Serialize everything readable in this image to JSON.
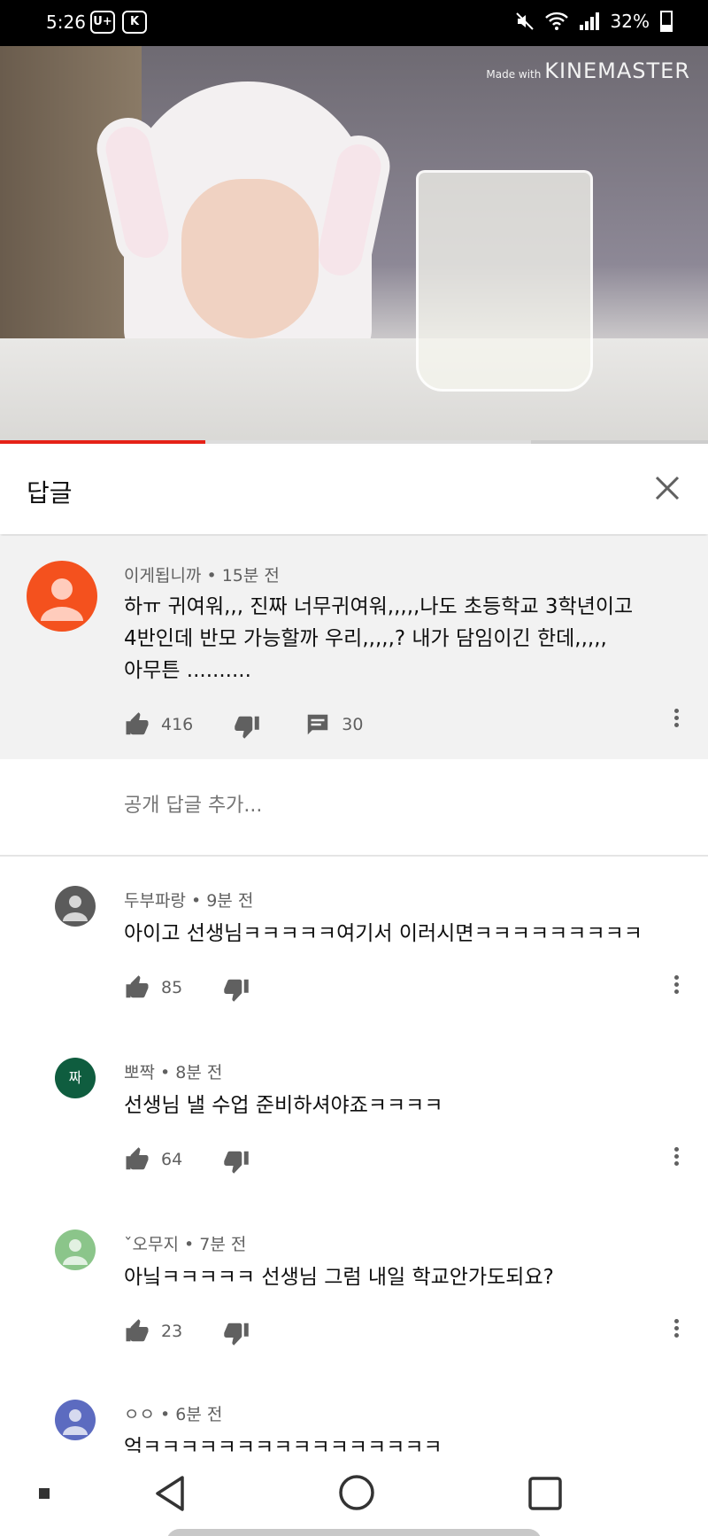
{
  "status_bar": {
    "time": "5:26",
    "left_icons": [
      "U+",
      "K"
    ],
    "right_icons": [
      "mute-icon",
      "wifi-icon",
      "signal-icon"
    ],
    "battery": "32%"
  },
  "video": {
    "watermark_prefix": "Made with",
    "watermark_brand": "KINEMASTER",
    "progress_fraction": 0.29,
    "buffered_fraction": 0.75
  },
  "header": {
    "title": "답글",
    "close_icon": "close-icon"
  },
  "parent_comment": {
    "author": "이게됩니까",
    "time": "15분 전",
    "text_lines": [
      "하ㅠ 귀여워,,, 진짜 너무귀여워,,,,,나도 초등학교 3학년이고",
      "4반인데 반모 가능할까 우리,,,,,? 내가 담임이긴 한데,,,,,",
      "아무튼 .........."
    ],
    "likes": "416",
    "replies": "30",
    "avatar_color": "#f4511e"
  },
  "add_reply": {
    "placeholder": "공개 답글 추가..."
  },
  "replies": [
    {
      "author": "두부파랑",
      "time": "9분 전",
      "text": "아이고 선생님ㅋㅋㅋㅋㅋ여기서 이러시면ㅋㅋㅋㅋㅋㅋㅋㅋㅋ",
      "likes": "85",
      "avatar_text": "",
      "avatar_color": "#5b5b5b"
    },
    {
      "author": "뽀짝",
      "time": "8분 전",
      "text": "선생님 낼 수업 준비하셔야죠ㅋㅋㅋㅋ",
      "likes": "64",
      "avatar_text": "짜",
      "avatar_color": "#0f5d3f"
    },
    {
      "author": "ˇ오무지",
      "time": "7분 전",
      "text": "아닠ㅋㅋㅋㅋㅋ 선생님 그럼 내일 학교안가도되요?",
      "likes": "23",
      "avatar_text": "",
      "avatar_color": "#8bc58a"
    },
    {
      "author": "ㅇㅇ",
      "time": "6분 전",
      "text": "억ㅋㅋㅋㅋㅋㅋㅋㅋㅋㅋㅋㅋㅋㅋㅋㅋ",
      "likes": "",
      "avatar_text": "",
      "avatar_color": "#5c6bc0"
    }
  ],
  "nav": [
    "back-icon",
    "home-icon",
    "recents-icon"
  ]
}
